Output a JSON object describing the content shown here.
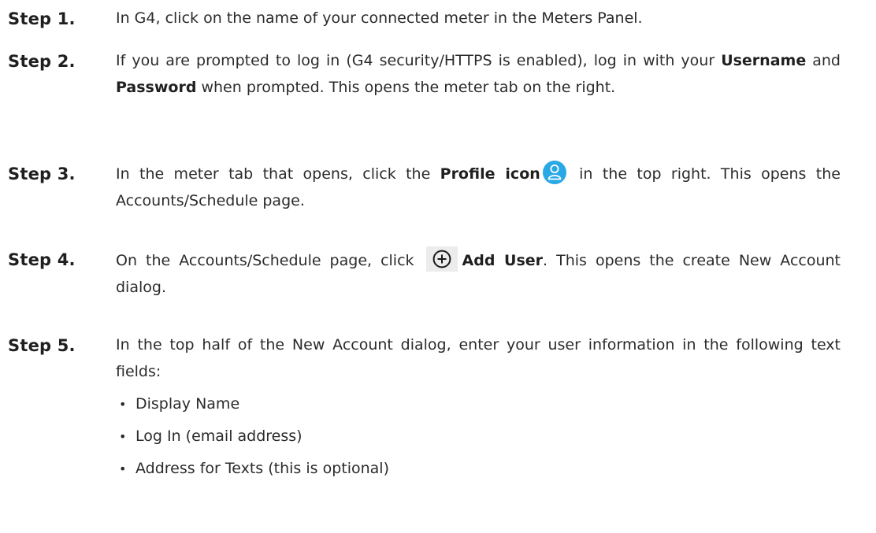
{
  "steps": [
    {
      "label": "Step 1.",
      "text": "In G4, click on the name of your connected meter in the Meters Panel."
    },
    {
      "label": "Step 2.",
      "text_a": "If you are prompted to log in (G4 security/HTTPS is enabled), log in with your ",
      "bold_a": "Username",
      "text_b": " and ",
      "bold_b": "Password",
      "text_c": " when prompted. This opens the meter tab on the right."
    },
    {
      "label": "Step 3.",
      "text_a": "In the meter tab that opens, click the ",
      "bold_a": "Profile icon",
      "icon": "profile-icon",
      "text_b": " in the top right. This opens the Accounts/Schedule page."
    },
    {
      "label": "Step 4.",
      "text_a": "On the Accounts/Schedule page, click ",
      "icon": "add-circle-icon",
      "bold_a": "Add User",
      "text_b": ". This opens the create New Account dialog."
    },
    {
      "label": "Step 5.",
      "text": "In the top half of the New Account dialog, enter your user information in the following text fields:",
      "bullets": [
        "Display Name",
        "Log In (email address)",
        "Address for Texts (this is optional)"
      ]
    }
  ],
  "colors": {
    "text": "#2b2b2b",
    "profile_icon_bg": "#29a8e6",
    "add_icon_box_bg": "#ececec"
  }
}
